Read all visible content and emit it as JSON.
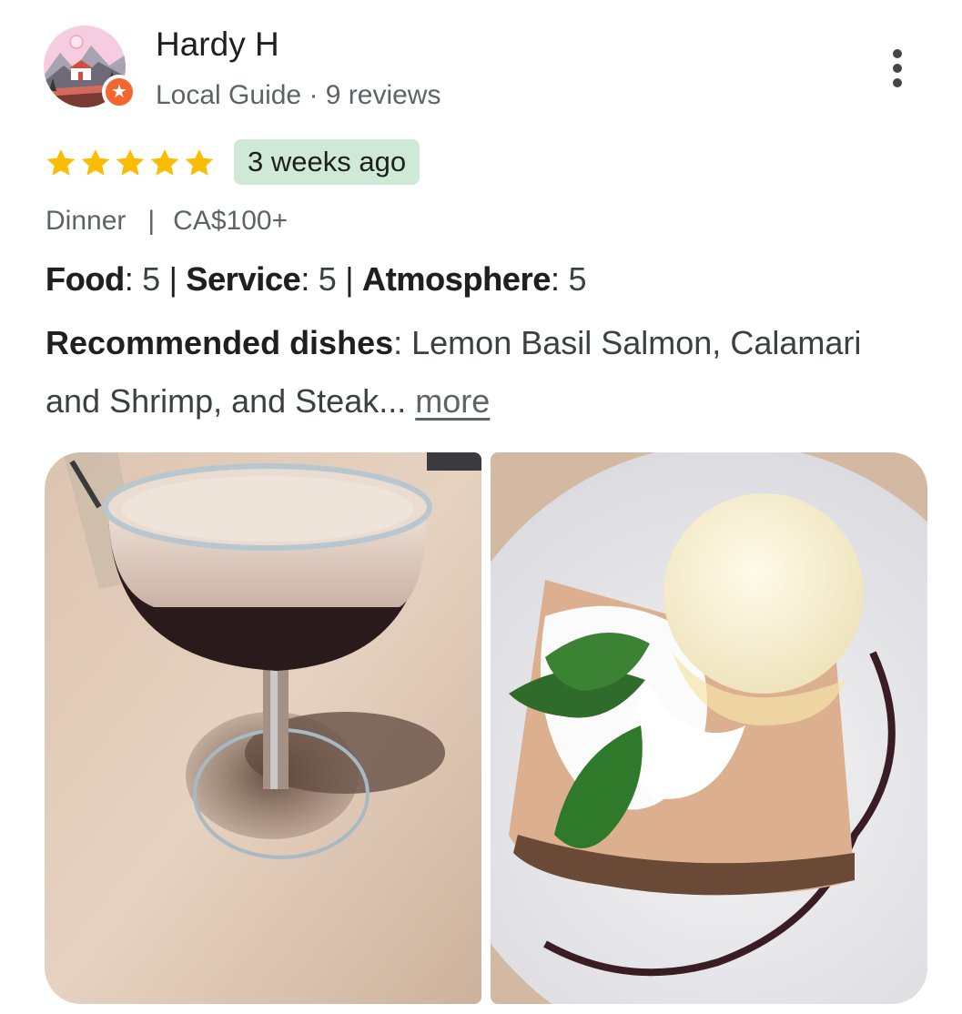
{
  "reviewer": {
    "name": "Hardy H",
    "meta": "Local Guide · 9 reviews",
    "avatar_icon": "landscape-avatar-icon",
    "badge_icon": "local-guide-star-icon"
  },
  "menu": {
    "icon": "more-vert-icon"
  },
  "review": {
    "rating": 5,
    "rating_max": 5,
    "time_ago": "3 weeks ago",
    "meal_type": "Dinner",
    "separator": "|",
    "price": "CA$100+",
    "scores": {
      "food_label": "Food",
      "food_value": "5",
      "service_label": "Service",
      "service_value": "5",
      "atmosphere_label": "Atmosphere",
      "atmosphere_value": "5"
    },
    "recommended_label": "Recommended dishes",
    "recommended_text": "Lemon Basil Salmon, Calamari and Shrimp, and Steak...",
    "more_label": "more"
  },
  "photos": [
    {
      "name": "espresso-martini-photo"
    },
    {
      "name": "dessert-with-ice-cream-photo"
    }
  ],
  "colors": {
    "star": "#fbbc04",
    "time_badge_bg": "#ceead6",
    "guide_badge": "#f4662f",
    "muted_text": "#5f6368"
  }
}
